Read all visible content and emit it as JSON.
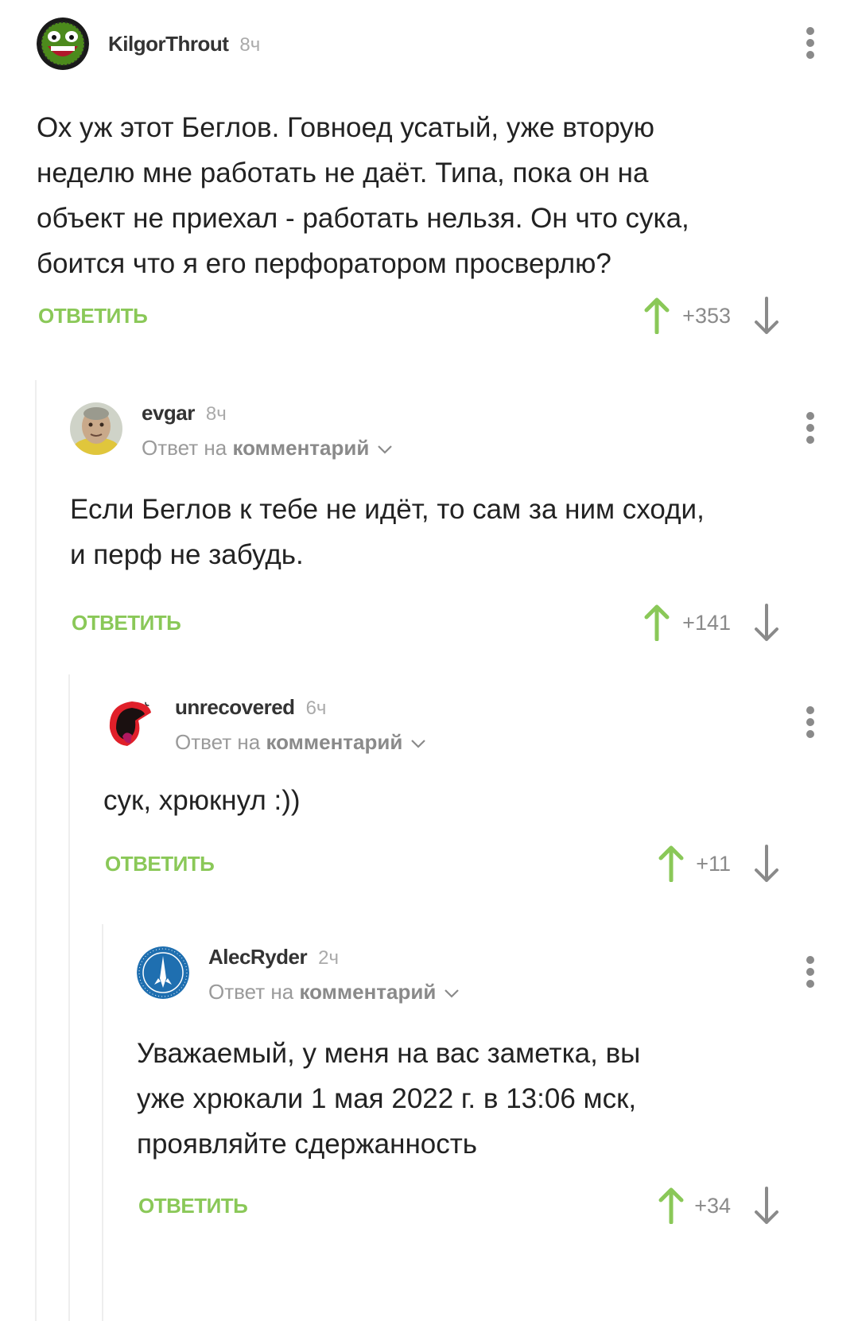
{
  "comments": [
    {
      "username": "KilgorThrout",
      "time": "8ч",
      "reply_to": null,
      "text": "Ох уж этот Беглов. Говноед усатый, уже вторую\nнеделю мне работать не даёт. Типа, пока он на\nобъект не приехал - работать нельзя. Он что сука,\nбоится что я его перфоратором просверлю?",
      "reply_label": "ОТВЕТИТЬ",
      "rating": "+353",
      "avatar": "awesome-face-icon"
    },
    {
      "username": "evgar",
      "time": "8ч",
      "reply_to": {
        "prefix": "Ответ на",
        "link": "комментарий"
      },
      "text": "Если Беглов к тебе не идёт, то сам за ним сходи,\nи перф не забудь.",
      "reply_label": "ОТВЕТИТЬ",
      "rating": "+141",
      "avatar": "old-man-avatar"
    },
    {
      "username": "unrecovered",
      "time": "6ч",
      "reply_to": {
        "prefix": "Ответ на",
        "link": "комментарий"
      },
      "text": "сук, хрюкнул :))",
      "reply_label": "ОТВЕТИТЬ",
      "rating": "+11",
      "avatar": "screaming-mouth-avatar"
    },
    {
      "username": "AlecRyder",
      "time": "2ч",
      "reply_to": {
        "prefix": "Ответ на",
        "link": "комментарий"
      },
      "text": "Уважаемый, у меня на вас заметка, вы\nуже хрюкали 1 мая 2022 г. в 13:06 мск,\nпроявляйте сдержанность",
      "reply_label": "ОТВЕТИТЬ",
      "rating": "+34",
      "avatar": "andromeda-initiative-logo"
    }
  ],
  "colors": {
    "accent_green": "#8ac858",
    "muted_gray": "#8a8a8a",
    "thread_line": "#eeeeee",
    "text": "#222222"
  },
  "icons": {
    "upvote": "arrow-up-icon",
    "downvote": "arrow-down-icon",
    "menu": "kebab-menu-icon",
    "expand": "chevron-down-icon"
  }
}
